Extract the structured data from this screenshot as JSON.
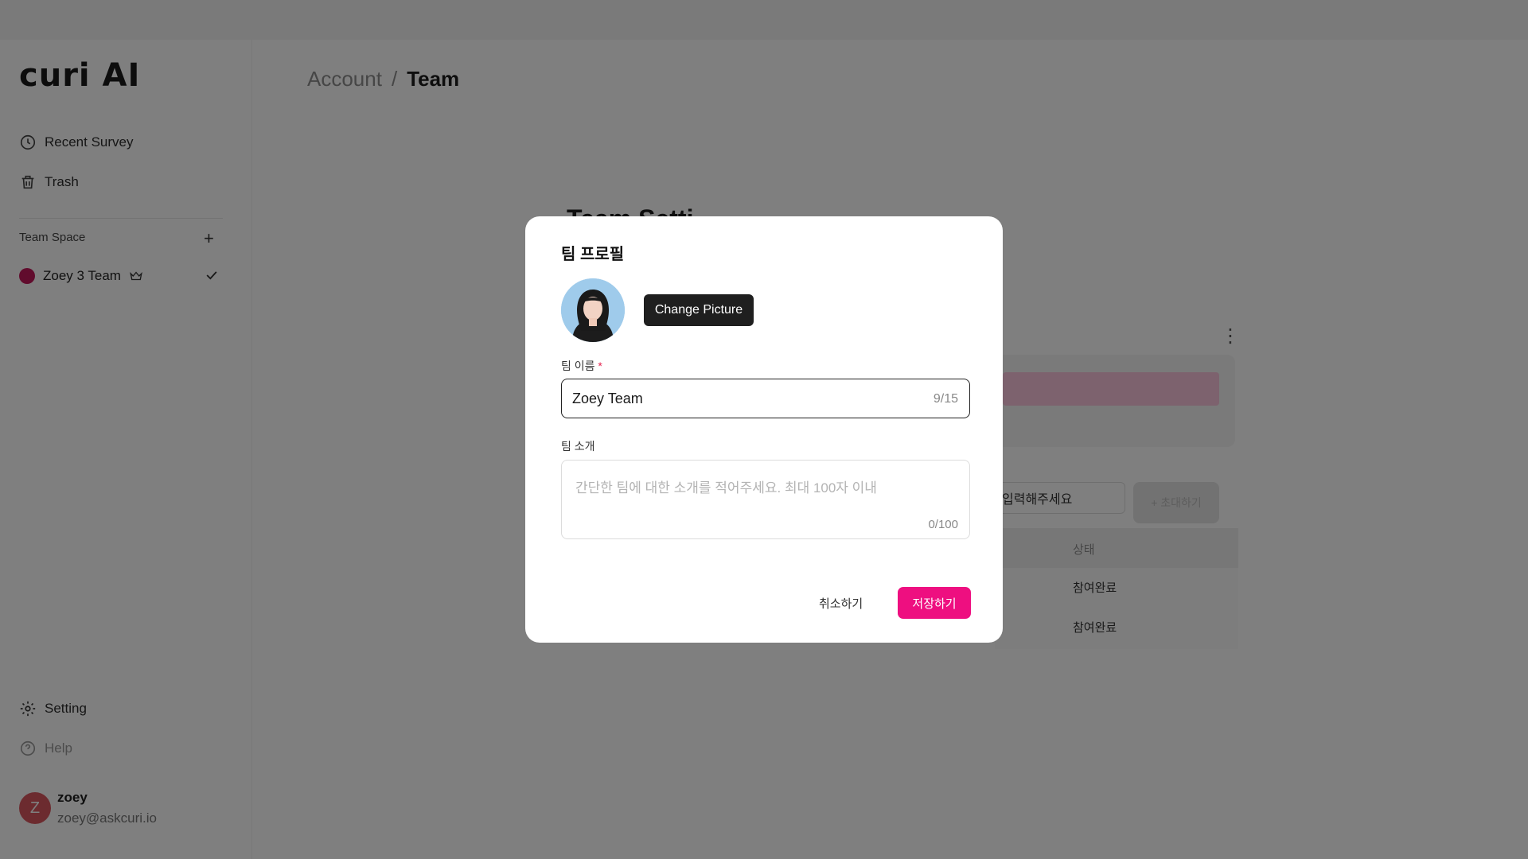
{
  "app": {
    "logo_text": "curi AI"
  },
  "sidebar": {
    "nav": [
      {
        "label": "Recent Survey",
        "icon": "clock-icon"
      },
      {
        "label": "Trash",
        "icon": "trash-icon"
      }
    ],
    "team_space_label": "Team Space",
    "team": {
      "name": "Zoey 3 Team",
      "color": "#c2185b"
    },
    "bottom": [
      {
        "label": "Setting",
        "icon": "gear-icon"
      },
      {
        "label": "Help",
        "icon": "help-icon"
      }
    ],
    "user": {
      "initial": "Z",
      "name": "zoey",
      "email": "zoey@askcuri.io"
    }
  },
  "breadcrumb": {
    "parent": "Account",
    "separator": "/",
    "current": "Team"
  },
  "background": {
    "title": "Team Setti",
    "invite_placeholder": "입력해주세요",
    "invite_button": "+ 초대하기",
    "table_header": "상태",
    "rows": [
      "참여완료",
      "참여완료"
    ]
  },
  "modal": {
    "title": "팀 프로필",
    "change_picture": "Change Picture",
    "name_label": "팀 이름",
    "required_mark": "*",
    "name_value": "Zoey Team",
    "name_count": "9/15",
    "desc_label": "팀 소개",
    "desc_placeholder": "간단한 팀에 대한 소개를 적어주세요. 최대 100자 이내",
    "desc_count": "0/100",
    "cancel": "취소하기",
    "save": "저장하기"
  },
  "colors": {
    "accent": "#ee0f80",
    "overlay": "rgba(0,0,0,0.5)"
  }
}
